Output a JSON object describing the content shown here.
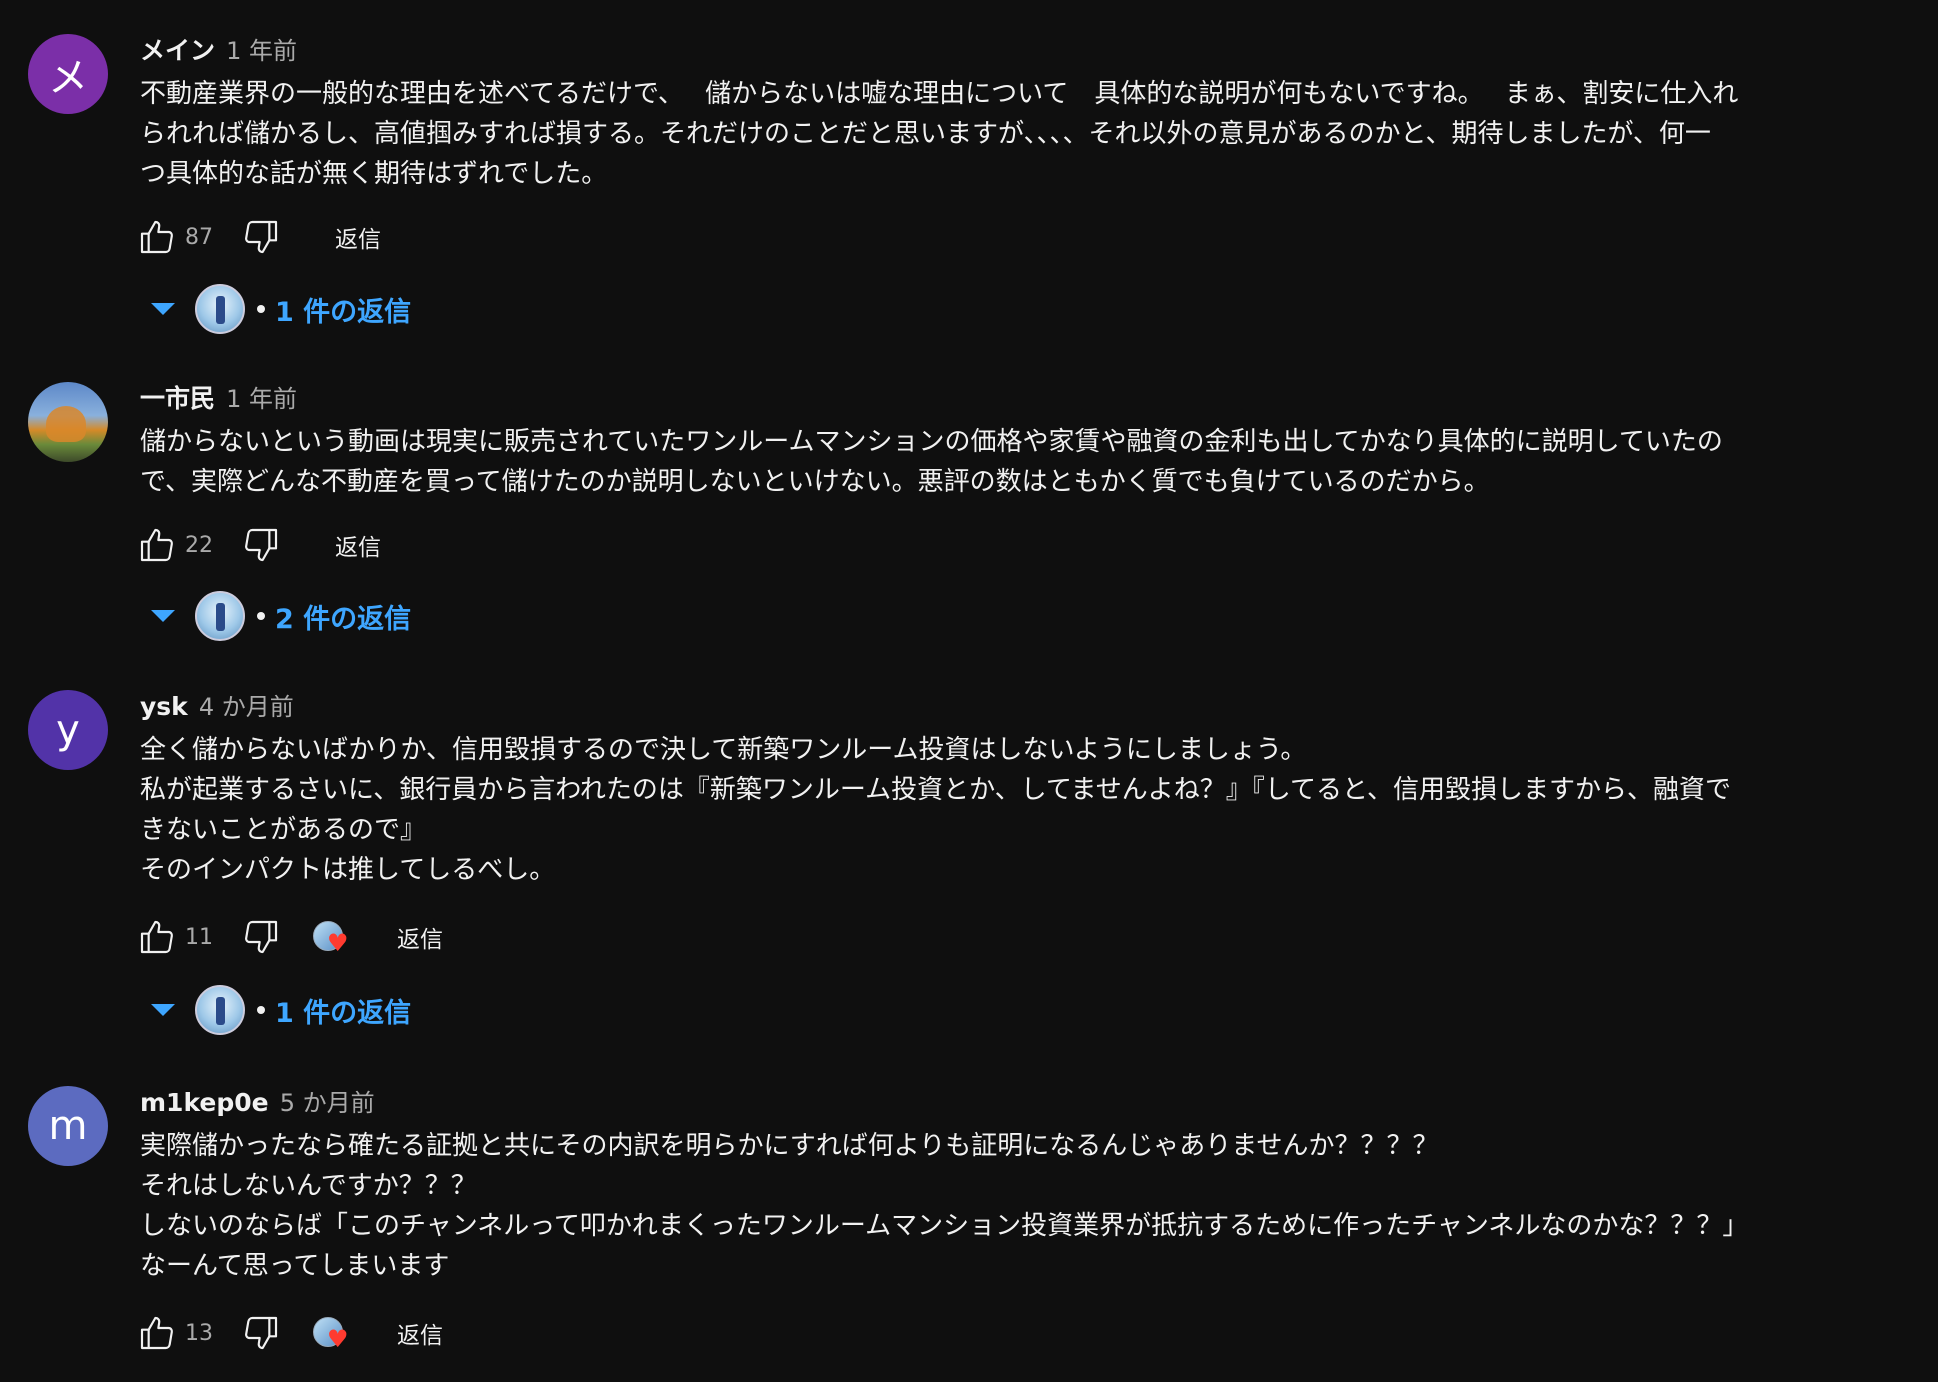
{
  "reply_button_label": "返信",
  "colors": {
    "background": "#0f0f0f",
    "link": "#3ea6ff",
    "heart": "#ff3b30"
  },
  "comments": [
    {
      "avatar_letter": "メ",
      "avatar_color": "#7b2fa8",
      "author": "メイン",
      "time": "1 年前",
      "text": "不動産業界の一般的な理由を述べてるだけで、　 儲からないは嘘な理由について　具体的な説明が何もないですね。　 まぁ、割安に仕入れ\nられれば儲かるし、高値掴みすれば損する。それだけのことだと思いますが、、、、それ以外の意見があるのかと、期待しましたが、何一\nつ具体的な話が無く期待はずれでした。",
      "likes": "87",
      "hearted": false,
      "replies_label": "1 件の返信"
    },
    {
      "avatar_letter": "",
      "avatar_color": "#4a7bb7",
      "author": "一市民",
      "time": "1 年前",
      "text": "儲からないという動画は現実に販売されていたワンルームマンションの価格や家賃や融資の金利も出してかなり具体的に説明していたの\nで、実際どんな不動産を買って儲けたのか説明しないといけない。悪評の数はともかく質でも負けているのだから。",
      "likes": "22",
      "hearted": false,
      "replies_label": "2 件の返信"
    },
    {
      "avatar_letter": "y",
      "avatar_color": "#5233a8",
      "author": "ysk",
      "time": "4 か月前",
      "text": "全く儲からないばかりか、信用毀損するので決して新築ワンルーム投資はしないようにしましょう。\n私が起業するさいに、銀行員から言われたのは『新築ワンルーム投資とか、してませんよね？』『してると、信用毀損しますから、融資で\nきないことがあるので』\nそのインパクトは推してしるべし。",
      "likes": "11",
      "hearted": true,
      "replies_label": "1 件の返信"
    },
    {
      "avatar_letter": "m",
      "avatar_color": "#5c6bc0",
      "author": "m1kep0e",
      "time": "5 か月前",
      "text": "実際儲かったなら確たる証拠と共にその内訳を明らかにすれば何よりも証明になるんじゃありませんか？？？？\nそれはしないんですか？？？\nしないのならば「このチャンネルって叩かれまくったワンルームマンション投資業界が抵抗するために作ったチャンネルなのかな？？？」\nなーんて思ってしまいます",
      "likes": "13",
      "hearted": true,
      "replies_label": ""
    }
  ]
}
